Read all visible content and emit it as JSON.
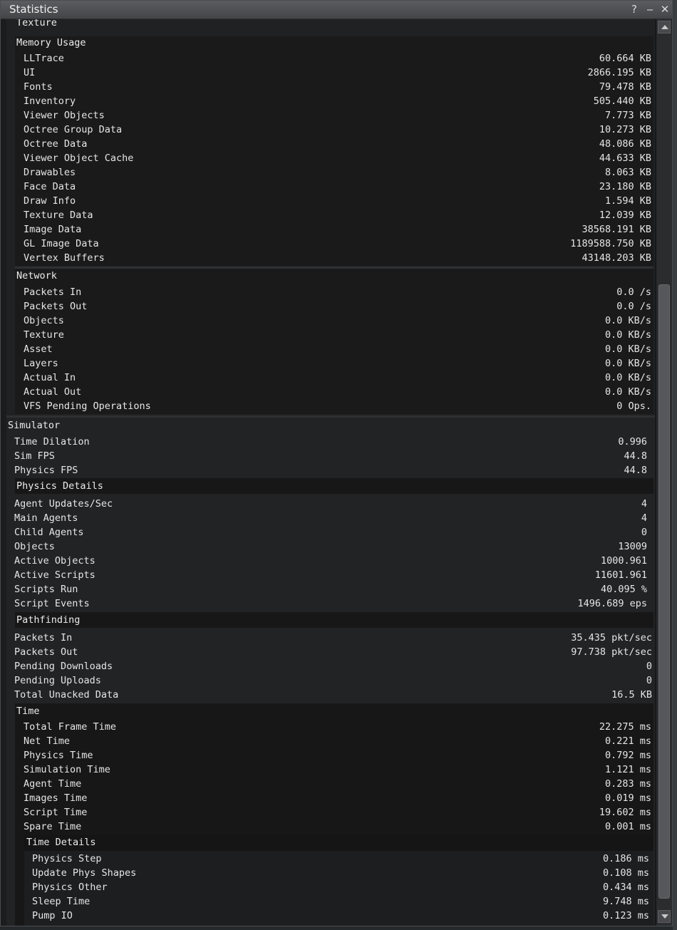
{
  "window": {
    "title": "Statistics",
    "help": "?",
    "minimize": "‒",
    "close": "✕"
  },
  "texture_header": "Texture",
  "memory": {
    "header": "Memory Usage",
    "rows": [
      {
        "label": "LLTrace",
        "value": "60.664 KB"
      },
      {
        "label": "UI",
        "value": "2866.195 KB"
      },
      {
        "label": "Fonts",
        "value": "79.478 KB"
      },
      {
        "label": "Inventory",
        "value": "505.440 KB"
      },
      {
        "label": "Viewer Objects",
        "value": "7.773 KB"
      },
      {
        "label": "Octree Group Data",
        "value": "10.273 KB"
      },
      {
        "label": "Octree Data",
        "value": "48.086 KB"
      },
      {
        "label": "Viewer Object Cache",
        "value": "44.633 KB"
      },
      {
        "label": "Drawables",
        "value": "8.063 KB"
      },
      {
        "label": "Face Data",
        "value": "23.180 KB"
      },
      {
        "label": "Draw Info",
        "value": "1.594 KB"
      },
      {
        "label": "Texture Data",
        "value": "12.039 KB"
      },
      {
        "label": "Image Data",
        "value": "38568.191 KB"
      },
      {
        "label": "GL Image Data",
        "value": "1189588.750 KB"
      },
      {
        "label": "Vertex Buffers",
        "value": "43148.203 KB"
      }
    ]
  },
  "network": {
    "header": "Network",
    "rows": [
      {
        "label": "Packets In",
        "value": "0.0 /s"
      },
      {
        "label": "Packets Out",
        "value": "0.0 /s"
      },
      {
        "label": "Objects",
        "value": "0.0 KB/s"
      },
      {
        "label": "Texture",
        "value": "0.0 KB/s"
      },
      {
        "label": "Asset",
        "value": "0.0 KB/s"
      },
      {
        "label": "Layers",
        "value": "0.0 KB/s"
      },
      {
        "label": "Actual In",
        "value": "0.0 KB/s"
      },
      {
        "label": "Actual Out",
        "value": "0.0 KB/s"
      },
      {
        "label": "VFS Pending Operations",
        "value": "0 Ops."
      }
    ]
  },
  "simulator": {
    "header": "Simulator",
    "rows": [
      {
        "label": "Time Dilation",
        "value": "0.996"
      },
      {
        "label": "Sim FPS",
        "value": "44.8"
      },
      {
        "label": "Physics FPS",
        "value": "44.8"
      }
    ],
    "physics_details": {
      "header": "Physics Details",
      "rows": [
        {
          "label": "Agent Updates/Sec",
          "value": "4"
        },
        {
          "label": "Main Agents",
          "value": "4"
        },
        {
          "label": "Child Agents",
          "value": "0"
        },
        {
          "label": "Objects",
          "value": "13009"
        },
        {
          "label": "Active Objects",
          "value": "1000.961"
        },
        {
          "label": "Active Scripts",
          "value": "11601.961"
        },
        {
          "label": "Scripts Run",
          "value": "40.095 %"
        },
        {
          "label": "Script Events",
          "value": "1496.689 eps"
        }
      ]
    },
    "pathfinding": {
      "header": "Pathfinding",
      "rows": [
        {
          "label": "Packets In",
          "value": "35.435 pkt/sec"
        },
        {
          "label": "Packets Out",
          "value": "97.738 pkt/sec"
        },
        {
          "label": "Pending Downloads",
          "value": "0"
        },
        {
          "label": "Pending Uploads",
          "value": "0"
        },
        {
          "label": "Total Unacked Data",
          "value": "16.5 KB"
        }
      ]
    },
    "time": {
      "header": "Time",
      "rows": [
        {
          "label": "Total Frame Time",
          "value": "22.275 ms"
        },
        {
          "label": "Net Time",
          "value": "0.221 ms"
        },
        {
          "label": "Physics Time",
          "value": "0.792 ms"
        },
        {
          "label": "Simulation Time",
          "value": "1.121 ms"
        },
        {
          "label": "Agent Time",
          "value": "0.283 ms"
        },
        {
          "label": "Images Time",
          "value": "0.019 ms"
        },
        {
          "label": "Script Time",
          "value": "19.602 ms"
        },
        {
          "label": "Spare Time",
          "value": "0.001 ms"
        }
      ],
      "time_details": {
        "header": "Time Details",
        "rows": [
          {
            "label": "Physics Step",
            "value": "0.186 ms"
          },
          {
            "label": "Update Phys Shapes",
            "value": "0.108 ms"
          },
          {
            "label": "Physics Other",
            "value": "0.434 ms"
          },
          {
            "label": "Sleep Time",
            "value": "9.748 ms"
          },
          {
            "label": "Pump IO",
            "value": "0.123 ms"
          }
        ]
      }
    }
  }
}
